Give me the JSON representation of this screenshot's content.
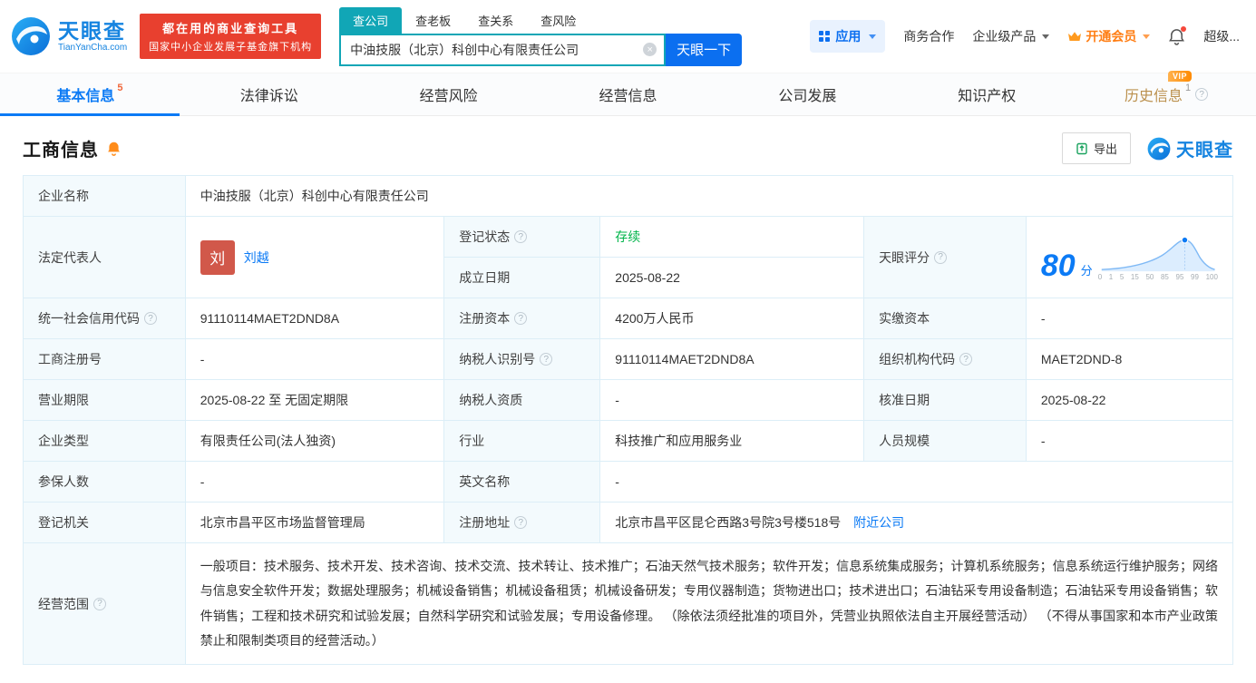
{
  "colors": {
    "brand_blue": "#1684e0",
    "accent_blue": "#0b7af5",
    "search_teal": "#11a6b6",
    "badge_red": "#e8402f",
    "status_green": "#00b44a",
    "vip_orange": "#ff7e14",
    "label_bg": "#f3fafd",
    "table_border": "#dceef7"
  },
  "brand": {
    "name": "天眼查",
    "domain": "TianYanCha.com",
    "slogan_line1": "都在用的商业查询工具",
    "slogan_line2": "国家中小企业发展子基金旗下机构"
  },
  "search": {
    "tabs": [
      {
        "label": "查公司"
      },
      {
        "label": "查老板"
      },
      {
        "label": "查关系"
      },
      {
        "label": "查风险"
      }
    ],
    "value": "中油技服（北京）科创中心有限责任公司",
    "button_label": "天眼一下"
  },
  "topnav": {
    "app_label": "应用",
    "biz_label": "商务合作",
    "enterprise_label": "企业级产品",
    "vip_label": "开通会员",
    "user_label": "超级..."
  },
  "tabs": {
    "basic": {
      "label": "基本信息",
      "count": "5"
    },
    "legal": {
      "label": "法律诉讼"
    },
    "risk": {
      "label": "经营风险"
    },
    "operation": {
      "label": "经营信息"
    },
    "development": {
      "label": "公司发展"
    },
    "ip": {
      "label": "知识产权"
    },
    "history": {
      "label": "历史信息",
      "count": "1",
      "badge": "VIP"
    }
  },
  "section": {
    "title": "工商信息",
    "export_label": "导出",
    "watermark": "天眼查"
  },
  "info": {
    "company_name": {
      "label": "企业名称",
      "value": "中油技服（北京）科创中心有限责任公司"
    },
    "legal_rep": {
      "label": "法定代表人",
      "avatar": "刘",
      "name": "刘越"
    },
    "reg_status": {
      "label": "登记状态",
      "value": "存续"
    },
    "establish_date": {
      "label": "成立日期",
      "value": "2025-08-22"
    },
    "score": {
      "label": "天眼评分",
      "value": "80",
      "unit": "分",
      "axis": [
        "0",
        "1",
        "5",
        "15",
        "50",
        "85",
        "95",
        "99",
        "100"
      ]
    },
    "credit_code": {
      "label": "统一社会信用代码",
      "value": "91110114MAET2DND8A"
    },
    "reg_capital": {
      "label": "注册资本",
      "value": "4200万人民币"
    },
    "paid_capital": {
      "label": "实缴资本",
      "value": "-"
    },
    "reg_number": {
      "label": "工商注册号",
      "value": "-"
    },
    "taxpayer_id": {
      "label": "纳税人识别号",
      "value": "91110114MAET2DND8A"
    },
    "org_code": {
      "label": "组织机构代码",
      "value": "MAET2DND-8"
    },
    "business_term": {
      "label": "营业期限",
      "value": "2025-08-22 至 无固定期限"
    },
    "taxpayer_quality": {
      "label": "纳税人资质",
      "value": "-"
    },
    "approval_date": {
      "label": "核准日期",
      "value": "2025-08-22"
    },
    "company_type": {
      "label": "企业类型",
      "value": "有限责任公司(法人独资)"
    },
    "industry": {
      "label": "行业",
      "value": "科技推广和应用服务业"
    },
    "staff_size": {
      "label": "人员规模",
      "value": "-"
    },
    "insured_count": {
      "label": "参保人数",
      "value": "-"
    },
    "english_name": {
      "label": "英文名称",
      "value": "-"
    },
    "reg_authority": {
      "label": "登记机关",
      "value": "北京市昌平区市场监督管理局"
    },
    "reg_address": {
      "label": "注册地址",
      "value": "北京市昌平区昆仑西路3号院3号楼518号",
      "link": "附近公司"
    },
    "business_scope": {
      "label": "经营范围",
      "value": "一般项目：技术服务、技术开发、技术咨询、技术交流、技术转让、技术推广；石油天然气技术服务；软件开发；信息系统集成服务；计算机系统服务；信息系统运行维护服务；网络与信息安全软件开发；数据处理服务；机械设备销售；机械设备租赁；机械设备研发；专用仪器制造；货物进出口；技术进出口；石油钻采专用设备制造；石油钻采专用设备销售；软件销售；工程和技术研究和试验发展；自然科学研究和试验发展；专用设备修理。 （除依法须经批准的项目外，凭营业执照依法自主开展经营活动） （不得从事国家和本市产业政策禁止和限制类项目的经营活动。）"
    }
  }
}
